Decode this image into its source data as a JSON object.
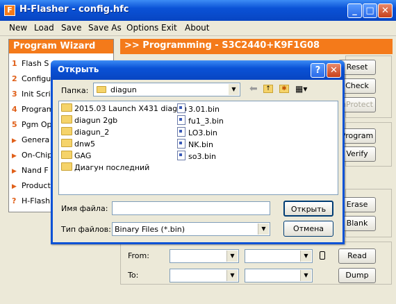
{
  "window": {
    "title": "H-Flasher - config.hfc",
    "icon_letter": "F"
  },
  "menu": [
    "New",
    "Load",
    "Save",
    "Save As",
    "Options",
    "Exit",
    "About"
  ],
  "wizard": {
    "title": "Program Wizard",
    "items": [
      {
        "marker": "1",
        "label": "Flash S"
      },
      {
        "marker": "2",
        "label": "Configu"
      },
      {
        "marker": "3",
        "label": "Init Scri"
      },
      {
        "marker": "4",
        "label": "Program"
      },
      {
        "marker": "5",
        "label": "Pgm Op"
      },
      {
        "marker": "▶",
        "label": "Genera"
      },
      {
        "marker": "▶",
        "label": "On-Chip"
      },
      {
        "marker": "▶",
        "label": "Nand F"
      },
      {
        "marker": "▶",
        "label": "Product"
      },
      {
        "marker": "?",
        "label": "H-Flash"
      }
    ]
  },
  "programming": {
    "header": ">> Programming - S3C2440+K9F1G08",
    "buttons": {
      "reset": "Reset",
      "check": "Check",
      "unprotect": "nProtect",
      "program": "Program",
      "verify": "Verify",
      "erase": "Erase",
      "blank": "Blank",
      "read": "Read",
      "dump": "Dump"
    },
    "from_label": "From:",
    "to_label": "To:"
  },
  "dialog": {
    "title": "Открыть",
    "lookin_label": "Папка:",
    "lookin_value": "diagun",
    "folders": [
      "2015.03 Launch X431 diagun",
      "diagun 2gb",
      "diagun_2",
      "dnw5",
      "GAG",
      "Диагун последний"
    ],
    "files": [
      "3.01.bin",
      "fu1_3.bin",
      "LO3.bin",
      "NK.bin",
      "so3.bin"
    ],
    "filename_label": "Имя файла:",
    "filename_value": "",
    "filetype_label": "Тип файлов:",
    "filetype_value": "Binary Files (*.bin)",
    "open_button": "Открыть",
    "cancel_button": "Отмена"
  }
}
